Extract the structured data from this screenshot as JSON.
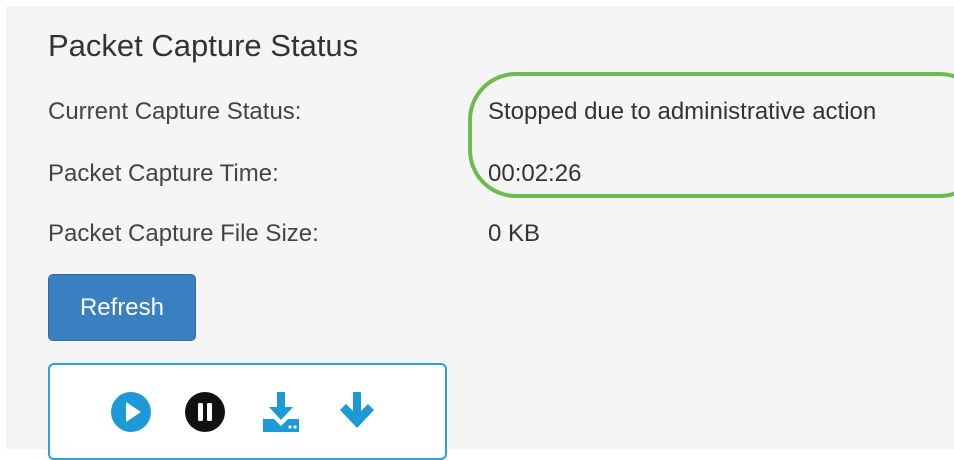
{
  "title": "Packet Capture Status",
  "rows": [
    {
      "label": "Current Capture Status:",
      "value": "Stopped due to administrative action"
    },
    {
      "label": "Packet Capture Time:",
      "value": "00:02:26"
    },
    {
      "label": "Packet Capture File Size:",
      "value": "0 KB"
    }
  ],
  "refresh_label": "Refresh",
  "toolbar": {
    "icons": [
      "play-icon",
      "pause-icon",
      "download-file-icon",
      "download-arrow-icon"
    ]
  },
  "colors": {
    "highlight": "#6cbb4d",
    "button": "#3a80c1",
    "icon_blue": "#1d9ad6",
    "icon_dark": "#111111",
    "toolbar_border": "#2d9fd9"
  }
}
